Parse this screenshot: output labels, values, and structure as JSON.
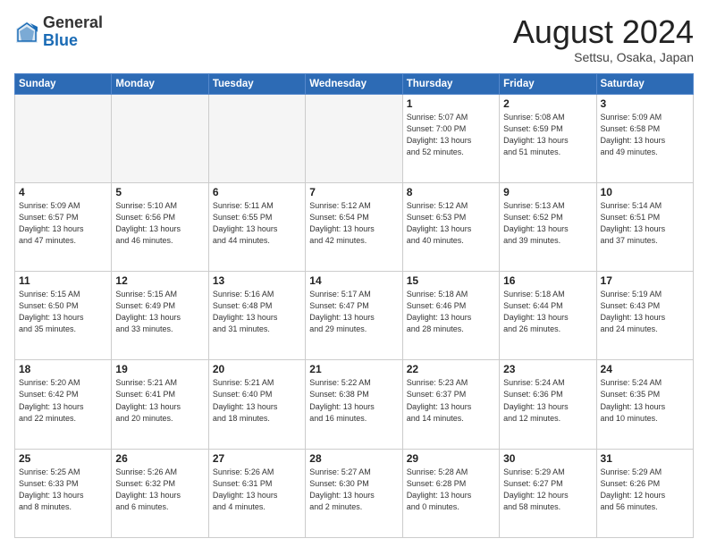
{
  "header": {
    "logo_general": "General",
    "logo_blue": "Blue",
    "month_year": "August 2024",
    "location": "Settsu, Osaka, Japan"
  },
  "weekdays": [
    "Sunday",
    "Monday",
    "Tuesday",
    "Wednesday",
    "Thursday",
    "Friday",
    "Saturday"
  ],
  "weeks": [
    [
      {
        "day": "",
        "info": ""
      },
      {
        "day": "",
        "info": ""
      },
      {
        "day": "",
        "info": ""
      },
      {
        "day": "",
        "info": ""
      },
      {
        "day": "1",
        "info": "Sunrise: 5:07 AM\nSunset: 7:00 PM\nDaylight: 13 hours\nand 52 minutes."
      },
      {
        "day": "2",
        "info": "Sunrise: 5:08 AM\nSunset: 6:59 PM\nDaylight: 13 hours\nand 51 minutes."
      },
      {
        "day": "3",
        "info": "Sunrise: 5:09 AM\nSunset: 6:58 PM\nDaylight: 13 hours\nand 49 minutes."
      }
    ],
    [
      {
        "day": "4",
        "info": "Sunrise: 5:09 AM\nSunset: 6:57 PM\nDaylight: 13 hours\nand 47 minutes."
      },
      {
        "day": "5",
        "info": "Sunrise: 5:10 AM\nSunset: 6:56 PM\nDaylight: 13 hours\nand 46 minutes."
      },
      {
        "day": "6",
        "info": "Sunrise: 5:11 AM\nSunset: 6:55 PM\nDaylight: 13 hours\nand 44 minutes."
      },
      {
        "day": "7",
        "info": "Sunrise: 5:12 AM\nSunset: 6:54 PM\nDaylight: 13 hours\nand 42 minutes."
      },
      {
        "day": "8",
        "info": "Sunrise: 5:12 AM\nSunset: 6:53 PM\nDaylight: 13 hours\nand 40 minutes."
      },
      {
        "day": "9",
        "info": "Sunrise: 5:13 AM\nSunset: 6:52 PM\nDaylight: 13 hours\nand 39 minutes."
      },
      {
        "day": "10",
        "info": "Sunrise: 5:14 AM\nSunset: 6:51 PM\nDaylight: 13 hours\nand 37 minutes."
      }
    ],
    [
      {
        "day": "11",
        "info": "Sunrise: 5:15 AM\nSunset: 6:50 PM\nDaylight: 13 hours\nand 35 minutes."
      },
      {
        "day": "12",
        "info": "Sunrise: 5:15 AM\nSunset: 6:49 PM\nDaylight: 13 hours\nand 33 minutes."
      },
      {
        "day": "13",
        "info": "Sunrise: 5:16 AM\nSunset: 6:48 PM\nDaylight: 13 hours\nand 31 minutes."
      },
      {
        "day": "14",
        "info": "Sunrise: 5:17 AM\nSunset: 6:47 PM\nDaylight: 13 hours\nand 29 minutes."
      },
      {
        "day": "15",
        "info": "Sunrise: 5:18 AM\nSunset: 6:46 PM\nDaylight: 13 hours\nand 28 minutes."
      },
      {
        "day": "16",
        "info": "Sunrise: 5:18 AM\nSunset: 6:44 PM\nDaylight: 13 hours\nand 26 minutes."
      },
      {
        "day": "17",
        "info": "Sunrise: 5:19 AM\nSunset: 6:43 PM\nDaylight: 13 hours\nand 24 minutes."
      }
    ],
    [
      {
        "day": "18",
        "info": "Sunrise: 5:20 AM\nSunset: 6:42 PM\nDaylight: 13 hours\nand 22 minutes."
      },
      {
        "day": "19",
        "info": "Sunrise: 5:21 AM\nSunset: 6:41 PM\nDaylight: 13 hours\nand 20 minutes."
      },
      {
        "day": "20",
        "info": "Sunrise: 5:21 AM\nSunset: 6:40 PM\nDaylight: 13 hours\nand 18 minutes."
      },
      {
        "day": "21",
        "info": "Sunrise: 5:22 AM\nSunset: 6:38 PM\nDaylight: 13 hours\nand 16 minutes."
      },
      {
        "day": "22",
        "info": "Sunrise: 5:23 AM\nSunset: 6:37 PM\nDaylight: 13 hours\nand 14 minutes."
      },
      {
        "day": "23",
        "info": "Sunrise: 5:24 AM\nSunset: 6:36 PM\nDaylight: 13 hours\nand 12 minutes."
      },
      {
        "day": "24",
        "info": "Sunrise: 5:24 AM\nSunset: 6:35 PM\nDaylight: 13 hours\nand 10 minutes."
      }
    ],
    [
      {
        "day": "25",
        "info": "Sunrise: 5:25 AM\nSunset: 6:33 PM\nDaylight: 13 hours\nand 8 minutes."
      },
      {
        "day": "26",
        "info": "Sunrise: 5:26 AM\nSunset: 6:32 PM\nDaylight: 13 hours\nand 6 minutes."
      },
      {
        "day": "27",
        "info": "Sunrise: 5:26 AM\nSunset: 6:31 PM\nDaylight: 13 hours\nand 4 minutes."
      },
      {
        "day": "28",
        "info": "Sunrise: 5:27 AM\nSunset: 6:30 PM\nDaylight: 13 hours\nand 2 minutes."
      },
      {
        "day": "29",
        "info": "Sunrise: 5:28 AM\nSunset: 6:28 PM\nDaylight: 13 hours\nand 0 minutes."
      },
      {
        "day": "30",
        "info": "Sunrise: 5:29 AM\nSunset: 6:27 PM\nDaylight: 12 hours\nand 58 minutes."
      },
      {
        "day": "31",
        "info": "Sunrise: 5:29 AM\nSunset: 6:26 PM\nDaylight: 12 hours\nand 56 minutes."
      }
    ]
  ]
}
